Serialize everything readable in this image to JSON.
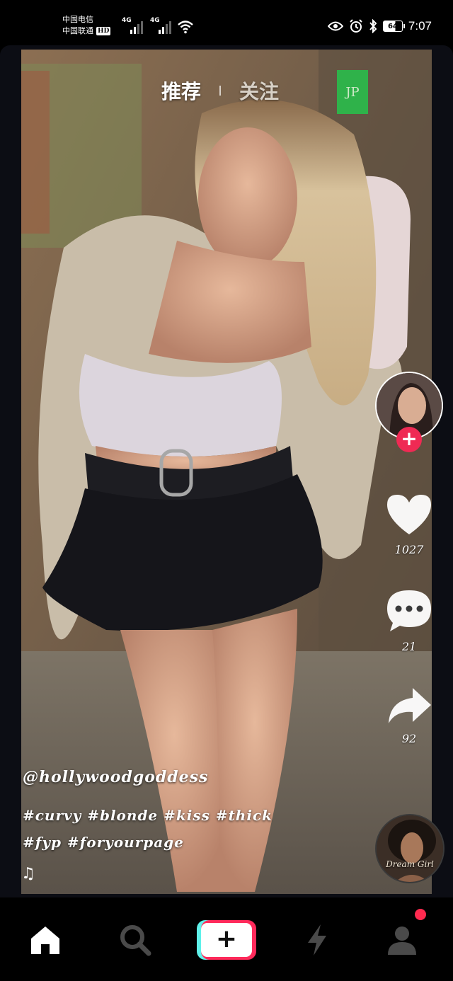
{
  "status_bar": {
    "carrier_1": "中国电信",
    "carrier_2": "中国联通",
    "hd_badge": "HD",
    "network_1": "4G",
    "network_2": "4G",
    "battery": "64",
    "time": "7:07"
  },
  "top_tabs": {
    "recommend": "推荐",
    "following": "关注",
    "badge": "JP"
  },
  "actions": {
    "like_count": "1027",
    "comment_count": "21",
    "share_count": "92"
  },
  "caption": {
    "username": "@hollywoodgoddess",
    "hashtags": "#curvy #blonde #kiss #thick #fyp #foryourpage"
  },
  "music": {
    "disc_label": "Dream Girl"
  },
  "bottom_nav": {
    "items": [
      "home-icon",
      "search-icon",
      "create-icon",
      "lightning-icon",
      "profile-icon"
    ],
    "active": "home-icon"
  },
  "colors": {
    "follow_plus": "#ef2a54",
    "create_cyan": "#5ff1ea",
    "create_pink": "#ff2a5b",
    "jp_badge": "#2fb24a"
  }
}
